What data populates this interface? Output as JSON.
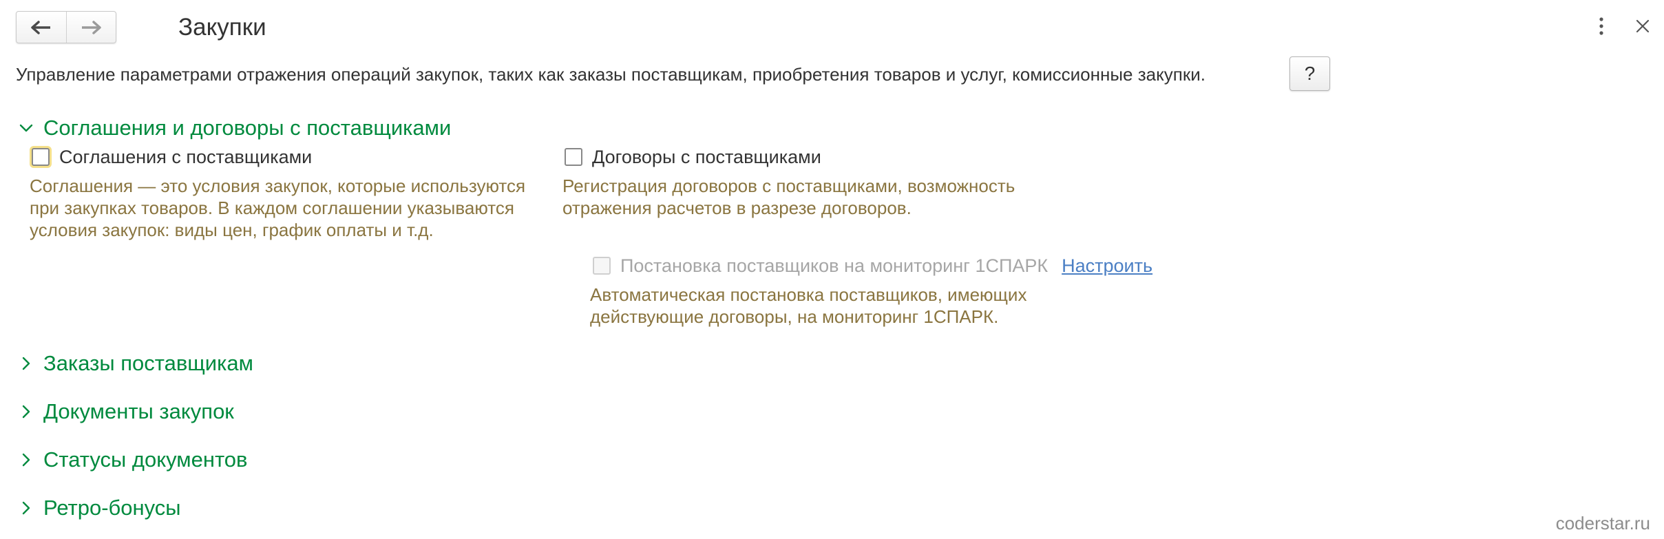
{
  "window": {
    "title": "Закупки",
    "description": "Управление параметрами отражения операций закупок, таких как заказы поставщикам, приобретения товаров и услуг, комиссионные закупки.",
    "help_label": "?",
    "icons": {
      "back": "arrow-left-icon",
      "forward": "arrow-right-icon",
      "more": "more-vertical-icon",
      "close": "close-icon"
    }
  },
  "sections": {
    "agreements": {
      "title": "Соглашения и договоры с поставщиками",
      "expanded": true,
      "agreements_option": {
        "label": "Соглашения с поставщиками",
        "checked": false,
        "hint": "Соглашения — это условия закупок, которые используются\nпри закупках товаров. В каждом соглашении указываются\nусловия закупок: виды цен, график оплаты и т.д."
      },
      "contracts_option": {
        "label": "Договоры с поставщиками",
        "checked": false,
        "hint": "Регистрация договоров с поставщиками, возможность\nотражения расчетов в разрезе договоров."
      },
      "monitoring_option": {
        "label": "Постановка поставщиков на мониторинг 1СПАРК",
        "checked": false,
        "enabled": false,
        "link": "Настроить",
        "hint": "Автоматическая постановка поставщиков, имеющих\nдействующие договоры, на мониторинг 1СПАРК."
      }
    },
    "orders": {
      "title": "Заказы поставщикам",
      "expanded": false
    },
    "documents": {
      "title": "Документы закупок",
      "expanded": false
    },
    "statuses": {
      "title": "Статусы документов",
      "expanded": false
    },
    "retro": {
      "title": "Ретро-бонусы",
      "expanded": false
    }
  },
  "watermark": "coderstar.ru",
  "colors": {
    "section_title": "#008a3e",
    "hint_text": "#8a7540",
    "link": "#4b7fc4",
    "focus_ring": "#f5e08a"
  }
}
